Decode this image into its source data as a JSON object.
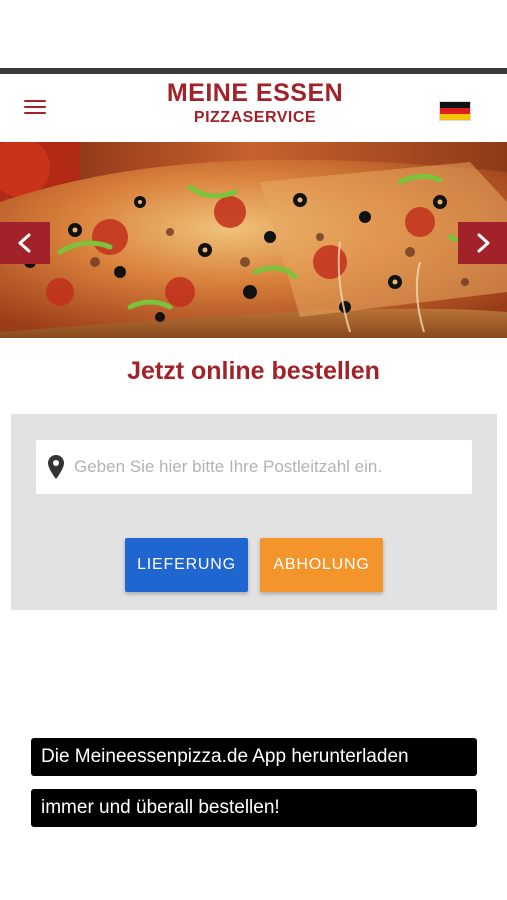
{
  "header": {
    "logo_main": "MEINE ESSEN",
    "logo_sub": "PIZZASERVICE",
    "menu_icon": "hamburger-menu-icon",
    "language_flag": "german-flag-icon"
  },
  "hero": {
    "image": "pizza-slice-photo",
    "prev_icon": "chevron-left-icon",
    "next_icon": "chevron-right-icon"
  },
  "order": {
    "headline": "Jetzt online bestellen",
    "zip_placeholder": "Geben Sie hier bitte Ihre Postleitzahl ein.",
    "zip_value": "",
    "delivery_label": "LIEFERUNG",
    "pickup_label": "ABHOLUNG"
  },
  "promo": {
    "line1": "Die Meineessenpizza.de App herunterladen",
    "line2": "immer und überall bestellen!"
  },
  "colors": {
    "brand": "#a2222a",
    "delivery": "#1f66d1",
    "pickup": "#f4952c",
    "panel": "#e2e2e2"
  }
}
